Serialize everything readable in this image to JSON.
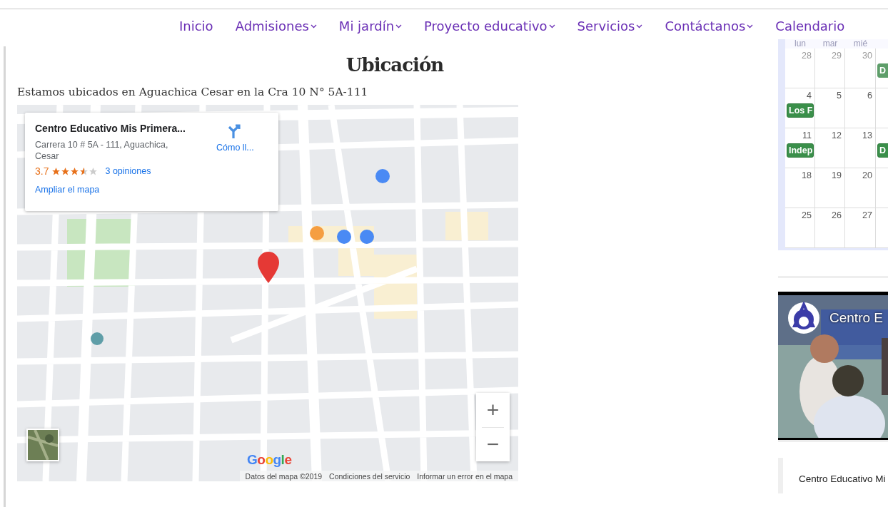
{
  "nav": [
    {
      "label": "Inicio",
      "dropdown": false
    },
    {
      "label": "Admisiones",
      "dropdown": true
    },
    {
      "label": "Mi jardín",
      "dropdown": true
    },
    {
      "label": "Proyecto educativo",
      "dropdown": true
    },
    {
      "label": "Servicios",
      "dropdown": true
    },
    {
      "label": "Contáctanos",
      "dropdown": true
    },
    {
      "label": "Calendario",
      "dropdown": false
    }
  ],
  "location": {
    "title": "Ubicación",
    "text": "Estamos ubicados en Aguachica Cesar en la Cra 10 N° 5A-111",
    "map": {
      "place": {
        "name": "Centro Educativo Mis Primera...",
        "address": "Carrera 10 # 5A - 111, Aguachica, Cesar",
        "rating": "3.7",
        "stars": 3.5,
        "reviews": "3 opiniones",
        "directions": "Cómo ll...",
        "enlarge": "Ampliar el mapa"
      },
      "zoom_in": "+",
      "zoom_out": "−",
      "logo": "Google",
      "attribution": [
        "Datos del mapa ©2019",
        "Condiciones del servicio",
        "Informar un error en el mapa"
      ]
    }
  },
  "calendar": {
    "weekdays": [
      "lun",
      "mar",
      "mié"
    ],
    "weeks": [
      {
        "faded": true,
        "days": [
          {
            "day": "28"
          },
          {
            "day": "29"
          },
          {
            "day": "30"
          },
          {
            "event": "D"
          }
        ]
      },
      {
        "faded": false,
        "days": [
          {
            "day": "4",
            "event": "Los F"
          },
          {
            "day": "5"
          },
          {
            "day": "6"
          }
        ]
      },
      {
        "faded": false,
        "days": [
          {
            "day": "11",
            "event": "Indep"
          },
          {
            "day": "12"
          },
          {
            "day": "13"
          },
          {
            "event": "D"
          }
        ]
      },
      {
        "faded": false,
        "days": [
          {
            "day": "18"
          },
          {
            "day": "19"
          },
          {
            "day": "20"
          }
        ]
      },
      {
        "faded": false,
        "days": [
          {
            "day": "25"
          },
          {
            "day": "26"
          },
          {
            "day": "27"
          }
        ]
      }
    ]
  },
  "video": {
    "title": "Centro E"
  },
  "side_box": {
    "text": "Centro Educativo Mi"
  }
}
